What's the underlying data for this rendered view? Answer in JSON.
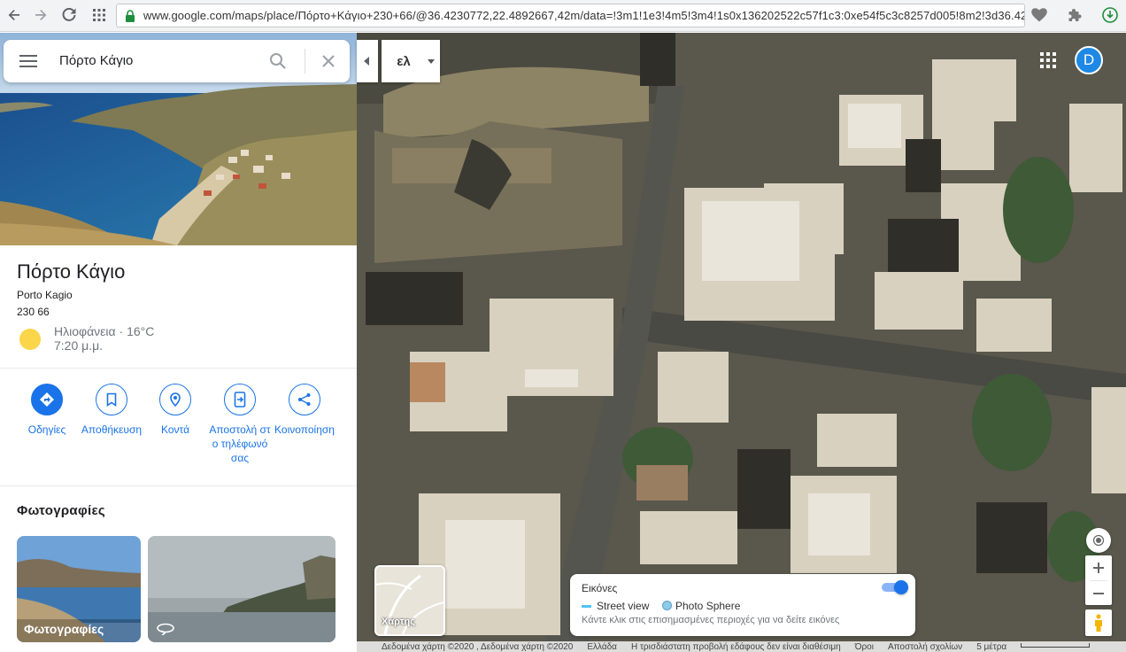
{
  "browser": {
    "url": "www.google.com/maps/place/Πόρτο+Κάγιο+230+66/@36.4230772,22.4892667,42m/data=!3m1!1e3!4m5!3m4!1s0x136202522c57f1c3:0xe54f5c3c8257d005!8m2!3d36.42"
  },
  "search": {
    "query": "Πόρτο Κάγιο"
  },
  "place": {
    "title": "Πόρτο Κάγιο",
    "latin_name": "Porto Kagio",
    "postal_code": "230 66",
    "weather": {
      "condition": "Ηλιοφάνεια · 16°C",
      "time": "7:20 μ.μ."
    }
  },
  "actions": [
    {
      "label": "Οδηγίες",
      "icon": "directions-icon"
    },
    {
      "label": "Αποθήκευση",
      "icon": "bookmark-icon"
    },
    {
      "label": "Κοντά",
      "icon": "nearby-icon"
    },
    {
      "label": "Αποστολή στο τηλέφωνό σας",
      "icon": "send-to-phone-icon"
    },
    {
      "label": "Κοινοποίηση",
      "icon": "share-icon"
    }
  ],
  "photos": {
    "heading": "Φωτογραφίες",
    "items": [
      {
        "label": "Φωτογραφίες"
      },
      {
        "label": ""
      }
    ]
  },
  "map": {
    "language_label": "ελ",
    "avatar_initial": "D",
    "minimap_label": "Χάρτης",
    "imagery": {
      "title": "Εικόνες",
      "street_view": "Street view",
      "photo_sphere": "Photo Sphere",
      "hint": "Κάντε κλικ στις επισημασμένες περιοχές για να δείτε εικόνες",
      "toggle_on": true
    },
    "footer": {
      "data": "Δεδομένα χάρτη ©2020 , Δεδομένα χάρτη ©2020",
      "region": "Ελλάδα",
      "terrain": "Η τρισδιάστατη προβολή εδάφους δεν είναι διαθέσιμη",
      "terms": "Όροι",
      "feedback": "Αποστολή σχολίων",
      "scale": "5 μέτρα"
    }
  },
  "colors": {
    "accent": "#1a73e8",
    "avatar": "#1e88e5"
  }
}
